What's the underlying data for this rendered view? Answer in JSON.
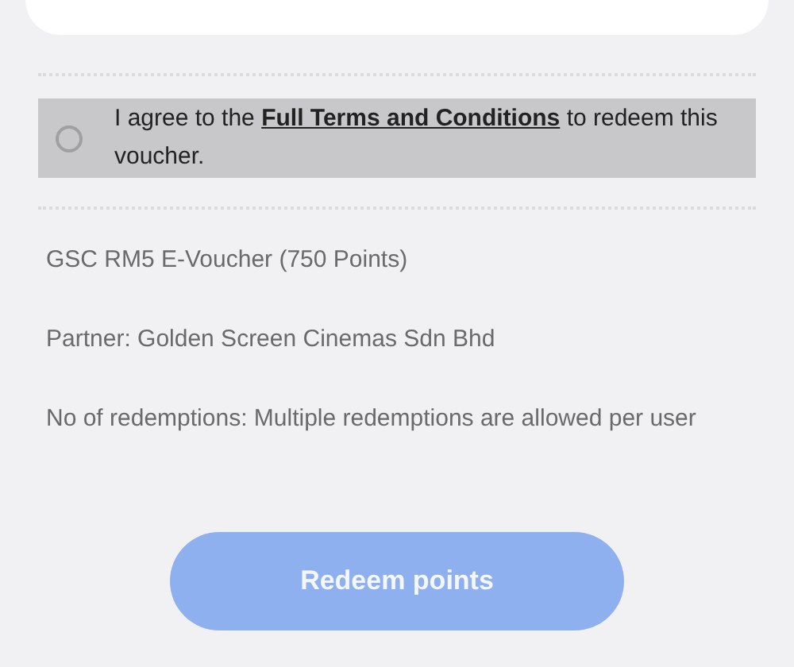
{
  "agreement": {
    "checked": false,
    "before": "I agree to the",
    "link": "Full Terms and Conditions",
    "after": "to redeem this voucher."
  },
  "details": [
    "GSC RM5 E-Voucher (750 Points)",
    "Partner: Golden Screen Cinemas Sdn Bhd",
    "No of redemptions: Multiple redemptions are allowed per user"
  ],
  "redeem_button": {
    "label": "Redeem points",
    "disabled": true
  }
}
